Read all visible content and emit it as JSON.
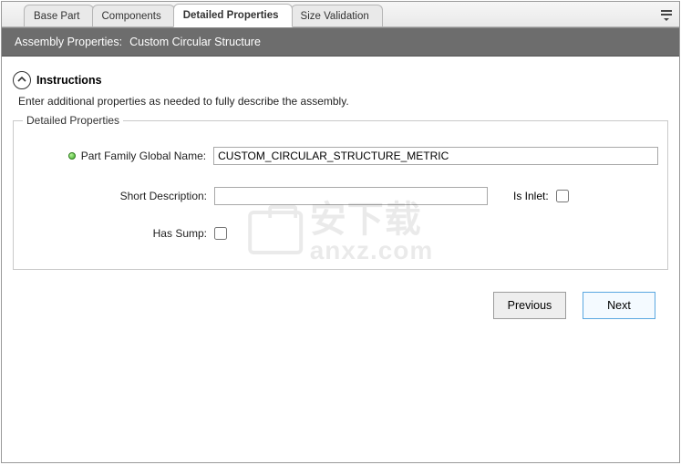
{
  "tabs": {
    "t0": "Base Part",
    "t1": "Components",
    "t2": "Detailed Properties",
    "t3": "Size Validation"
  },
  "subheader": {
    "prefix": "Assembly Properties:",
    "name": "Custom Circular Structure"
  },
  "instructions": {
    "title": "Instructions",
    "text": "Enter additional properties as needed to fully describe the assembly."
  },
  "group": {
    "legend": "Detailed Properties",
    "partFamilyLabel": "Part Family Global Name:",
    "partFamilyValue": "CUSTOM_CIRCULAR_STRUCTURE_METRIC",
    "shortDescLabel": "Short Description:",
    "shortDescValue": "",
    "isInletLabel": "Is Inlet:",
    "hasSumpLabel": "Has Sump:"
  },
  "buttons": {
    "prev": "Previous",
    "next": "Next"
  },
  "watermark": {
    "text1": "安下载",
    "text2": "anxz.com"
  }
}
